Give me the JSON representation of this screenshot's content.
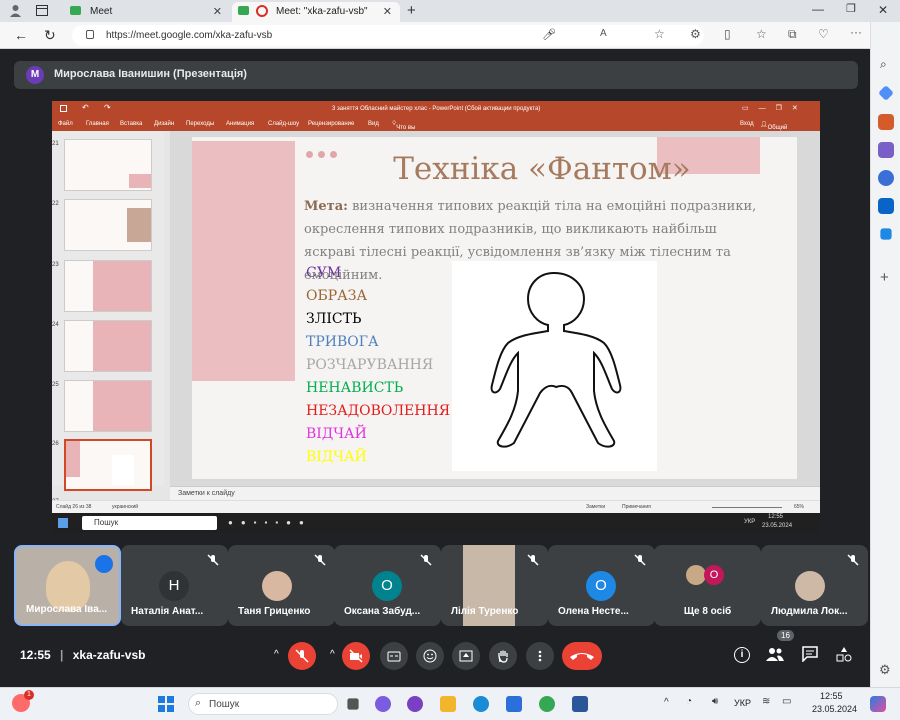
{
  "browser": {
    "tab1_title": "Meet",
    "tab2_title": "Meet: \"xka-zafu-vsb\"",
    "url": "https://meet.google.com/xka-zafu-vsb"
  },
  "meet": {
    "presenter_initial": "M",
    "presenter_label": "Мирослава Іванишин (Презентація)",
    "time": "12:55",
    "meeting_code": "xka-zafu-vsb",
    "participant_count": "16",
    "participants": [
      {
        "name": "Мирослава Іва...",
        "type": "video"
      },
      {
        "name": "Наталія Анат...",
        "initial": "Н",
        "color": "#3c4043"
      },
      {
        "name": "Таня Гриценко",
        "type": "video"
      },
      {
        "name": "Оксана Забуд...",
        "initial": "О",
        "color": "#00838f"
      },
      {
        "name": "Лілія Туренко",
        "type": "video"
      },
      {
        "name": "Олена Несте...",
        "initial": "О",
        "color": "#1e88e5"
      },
      {
        "name": "Ще 8 осіб",
        "initial": "О",
        "color": "#c2185b"
      },
      {
        "name": "Людмила Лок...",
        "type": "video"
      }
    ]
  },
  "ppt": {
    "window_title": "3 заняття Обласний майстер хлас - PowerPoint (Сбой активации продукта)",
    "menu": [
      "Файл",
      "Главная",
      "Вставка",
      "Дизайн",
      "Переходы",
      "Анимация",
      "Слайд-шоу",
      "Рецензирование",
      "Вид"
    ],
    "tell_me": "Что вы хотите сделать?",
    "login": "Вход",
    "share": "Общий доступ",
    "thumb_numbers": [
      "21",
      "22",
      "23",
      "24",
      "25",
      "26",
      "27"
    ],
    "notes_placeholder": "Заметки к слайду",
    "status_slide": "Слайд 26 из 38",
    "status_lang": "украинский",
    "status_notes": "Заметки",
    "status_comments": "Примечания",
    "status_zoom": "65%",
    "slide": {
      "title": "Техніка «Фантом»",
      "goal_label": "Мета:",
      "goal_text": " визначення типових реакцій тіла на емоційні подразники, окреслення типових подразників, що викликають найбільш яскраві тілесні реакції, усвідомлення зв’язку між тілесним та емоційним.",
      "emotions": [
        {
          "text": "СУМ",
          "color": "#7030a0"
        },
        {
          "text": "ОБРАЗА",
          "color": "#996633"
        },
        {
          "text": "ЗЛІСТЬ",
          "color": "#000000"
        },
        {
          "text": "ТРИВОГА",
          "color": "#4f81bd"
        },
        {
          "text": "РОЗЧАРУВАННЯ",
          "color": "#a6a6a6"
        },
        {
          "text": "НЕНАВИСТЬ",
          "color": "#00b050"
        },
        {
          "text": "НЕЗАДОВОЛЕННЯ",
          "color": "#e31b1b"
        },
        {
          "text": "ВІДЧАЙ",
          "color": "#e233e2"
        },
        {
          "text": "ВІДЧАЙ",
          "color": "#ffff00"
        }
      ]
    }
  },
  "inner_taskbar": {
    "search": "Пошук",
    "time": "12:55",
    "date": "23.05.2024",
    "lang": "УКР"
  },
  "taskbar": {
    "search": "Пошук",
    "lang": "УКР",
    "time": "12:55",
    "date": "23.05.2024",
    "notif_badge": "1"
  }
}
